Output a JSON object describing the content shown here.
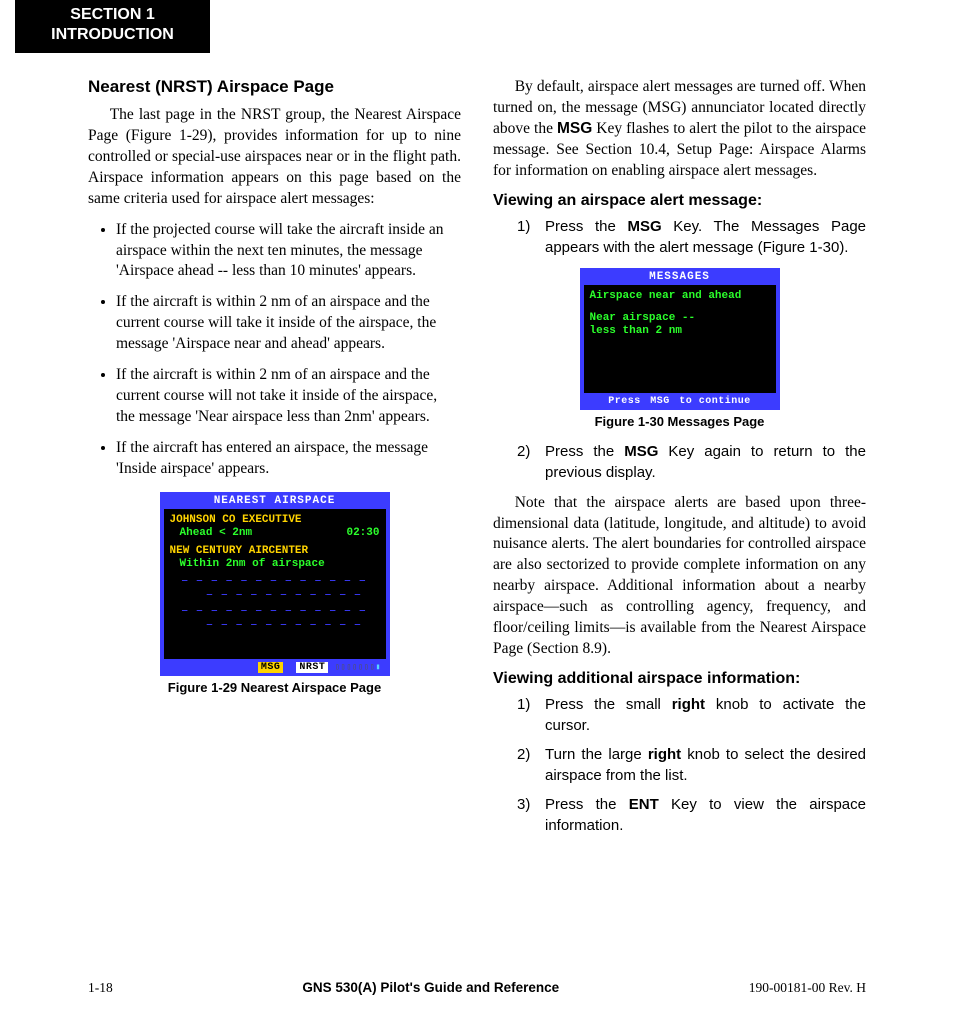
{
  "section_tab": {
    "l1": "SECTION 1",
    "l2": "INTRODUCTION"
  },
  "left": {
    "heading": "Nearest (NRST) Airspace Page",
    "p1": "The last page in the NRST group, the Nearest Airspace Page (Figure 1-29), provides information for up to nine controlled or special-use airspaces near or in the flight path.  Airspace information appears on this page based on the same criteria used for airspace alert messages:",
    "bullets": [
      "If the projected course will take the aircraft inside an airspace within the next ten minutes, the message 'Airspace ahead -- less than 10 minutes' appears.",
      "If the aircraft is within 2 nm of an airspace and the current course will take it inside of the airspace, the message 'Airspace near and ahead' appears.",
      "If the aircraft is within 2 nm of an airspace and the current course will not take it inside of the airspace, the message 'Near airspace less than 2nm' appears.",
      "If the aircraft has entered an airspace, the message 'Inside airspace' appears."
    ],
    "fig1": {
      "title": "NEAREST AIRSPACE",
      "a1_name": "JOHNSON CO EXECUTIVE",
      "a1_status": "Ahead < 2nm",
      "a1_time": "02:30",
      "a2_name": "NEW CENTURY AIRCENTER",
      "a2_status": "Within 2nm of airspace",
      "msg": "MSG",
      "nrst": "NRST",
      "caption": "Figure 1-29  Nearest Airspace Page"
    }
  },
  "right": {
    "p1a": "By default, airspace alert messages are turned off.  When turned on, the message (MSG) annunciator located directly above the ",
    "p1b": "MSG",
    "p1c": " Key flashes to alert the pilot to the airspace message.  See Section 10.4, Setup Page: Airspace Alarms for information on enabling airspace alert messages.",
    "sub1": "Viewing an airspace alert message:",
    "s1_1a": "Press the ",
    "s1_1b": "MSG",
    "s1_1c": " Key.  The Messages Page appears with the alert message (Figure 1-30).",
    "fig2": {
      "title": "MESSAGES",
      "l1": "Airspace near and ahead",
      "l2": "Near airspace --",
      "l3": "  less than 2 nm",
      "prompt_a": "Press",
      "prompt_b": "MSG",
      "prompt_c": "to continue",
      "caption": "Figure 1-30  Messages Page"
    },
    "s1_2a": "Press the ",
    "s1_2b": "MSG",
    "s1_2c": " Key again to return to the previous display.",
    "p2": "Note that the airspace alerts are based upon three-dimensional data (latitude, longitude, and altitude) to avoid nuisance alerts.  The alert boundaries for controlled airspace are also sectorized to provide complete information on any nearby airspace.  Additional information about a nearby airspace—such as controlling agency, frequency, and floor/ceiling limits—is available from the Nearest Airspace Page (Section 8.9).",
    "sub2": "Viewing additional airspace information:",
    "s2_1a": "Press the small ",
    "s2_1b": "right",
    "s2_1c": " knob to activate the cursor.",
    "s2_2a": "Turn the large ",
    "s2_2b": "right",
    "s2_2c": " knob to select the desired airspace from the list.",
    "s2_3a": "Press the ",
    "s2_3b": "ENT",
    "s2_3c": " Key to view the airspace information."
  },
  "footer": {
    "left": "1-18",
    "center": "GNS 530(A) Pilot's Guide and Reference",
    "right": "190-00181-00  Rev. H"
  }
}
